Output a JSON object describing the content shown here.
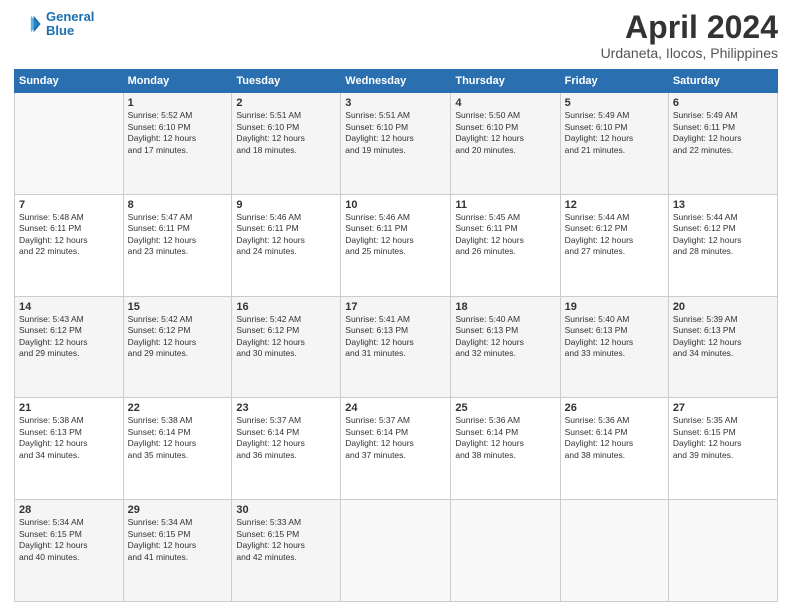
{
  "header": {
    "logo_line1": "General",
    "logo_line2": "Blue",
    "month": "April 2024",
    "location": "Urdaneta, Ilocos, Philippines"
  },
  "weekdays": [
    "Sunday",
    "Monday",
    "Tuesday",
    "Wednesday",
    "Thursday",
    "Friday",
    "Saturday"
  ],
  "weeks": [
    [
      {
        "day": "",
        "info": ""
      },
      {
        "day": "1",
        "info": "Sunrise: 5:52 AM\nSunset: 6:10 PM\nDaylight: 12 hours\nand 17 minutes."
      },
      {
        "day": "2",
        "info": "Sunrise: 5:51 AM\nSunset: 6:10 PM\nDaylight: 12 hours\nand 18 minutes."
      },
      {
        "day": "3",
        "info": "Sunrise: 5:51 AM\nSunset: 6:10 PM\nDaylight: 12 hours\nand 19 minutes."
      },
      {
        "day": "4",
        "info": "Sunrise: 5:50 AM\nSunset: 6:10 PM\nDaylight: 12 hours\nand 20 minutes."
      },
      {
        "day": "5",
        "info": "Sunrise: 5:49 AM\nSunset: 6:10 PM\nDaylight: 12 hours\nand 21 minutes."
      },
      {
        "day": "6",
        "info": "Sunrise: 5:49 AM\nSunset: 6:11 PM\nDaylight: 12 hours\nand 22 minutes."
      }
    ],
    [
      {
        "day": "7",
        "info": "Sunrise: 5:48 AM\nSunset: 6:11 PM\nDaylight: 12 hours\nand 22 minutes."
      },
      {
        "day": "8",
        "info": "Sunrise: 5:47 AM\nSunset: 6:11 PM\nDaylight: 12 hours\nand 23 minutes."
      },
      {
        "day": "9",
        "info": "Sunrise: 5:46 AM\nSunset: 6:11 PM\nDaylight: 12 hours\nand 24 minutes."
      },
      {
        "day": "10",
        "info": "Sunrise: 5:46 AM\nSunset: 6:11 PM\nDaylight: 12 hours\nand 25 minutes."
      },
      {
        "day": "11",
        "info": "Sunrise: 5:45 AM\nSunset: 6:11 PM\nDaylight: 12 hours\nand 26 minutes."
      },
      {
        "day": "12",
        "info": "Sunrise: 5:44 AM\nSunset: 6:12 PM\nDaylight: 12 hours\nand 27 minutes."
      },
      {
        "day": "13",
        "info": "Sunrise: 5:44 AM\nSunset: 6:12 PM\nDaylight: 12 hours\nand 28 minutes."
      }
    ],
    [
      {
        "day": "14",
        "info": "Sunrise: 5:43 AM\nSunset: 6:12 PM\nDaylight: 12 hours\nand 29 minutes."
      },
      {
        "day": "15",
        "info": "Sunrise: 5:42 AM\nSunset: 6:12 PM\nDaylight: 12 hours\nand 29 minutes."
      },
      {
        "day": "16",
        "info": "Sunrise: 5:42 AM\nSunset: 6:12 PM\nDaylight: 12 hours\nand 30 minutes."
      },
      {
        "day": "17",
        "info": "Sunrise: 5:41 AM\nSunset: 6:13 PM\nDaylight: 12 hours\nand 31 minutes."
      },
      {
        "day": "18",
        "info": "Sunrise: 5:40 AM\nSunset: 6:13 PM\nDaylight: 12 hours\nand 32 minutes."
      },
      {
        "day": "19",
        "info": "Sunrise: 5:40 AM\nSunset: 6:13 PM\nDaylight: 12 hours\nand 33 minutes."
      },
      {
        "day": "20",
        "info": "Sunrise: 5:39 AM\nSunset: 6:13 PM\nDaylight: 12 hours\nand 34 minutes."
      }
    ],
    [
      {
        "day": "21",
        "info": "Sunrise: 5:38 AM\nSunset: 6:13 PM\nDaylight: 12 hours\nand 34 minutes."
      },
      {
        "day": "22",
        "info": "Sunrise: 5:38 AM\nSunset: 6:14 PM\nDaylight: 12 hours\nand 35 minutes."
      },
      {
        "day": "23",
        "info": "Sunrise: 5:37 AM\nSunset: 6:14 PM\nDaylight: 12 hours\nand 36 minutes."
      },
      {
        "day": "24",
        "info": "Sunrise: 5:37 AM\nSunset: 6:14 PM\nDaylight: 12 hours\nand 37 minutes."
      },
      {
        "day": "25",
        "info": "Sunrise: 5:36 AM\nSunset: 6:14 PM\nDaylight: 12 hours\nand 38 minutes."
      },
      {
        "day": "26",
        "info": "Sunrise: 5:36 AM\nSunset: 6:14 PM\nDaylight: 12 hours\nand 38 minutes."
      },
      {
        "day": "27",
        "info": "Sunrise: 5:35 AM\nSunset: 6:15 PM\nDaylight: 12 hours\nand 39 minutes."
      }
    ],
    [
      {
        "day": "28",
        "info": "Sunrise: 5:34 AM\nSunset: 6:15 PM\nDaylight: 12 hours\nand 40 minutes."
      },
      {
        "day": "29",
        "info": "Sunrise: 5:34 AM\nSunset: 6:15 PM\nDaylight: 12 hours\nand 41 minutes."
      },
      {
        "day": "30",
        "info": "Sunrise: 5:33 AM\nSunset: 6:15 PM\nDaylight: 12 hours\nand 42 minutes."
      },
      {
        "day": "",
        "info": ""
      },
      {
        "day": "",
        "info": ""
      },
      {
        "day": "",
        "info": ""
      },
      {
        "day": "",
        "info": ""
      }
    ]
  ]
}
